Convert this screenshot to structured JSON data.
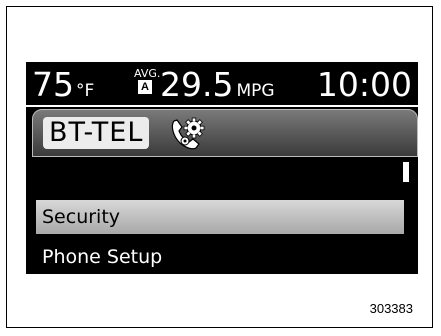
{
  "status": {
    "temperature": "75",
    "temperature_unit": "°F",
    "avg_label": "AVG.",
    "avg_badge": "A",
    "mpg_value": "29.5",
    "mpg_unit": "MPG",
    "time": "10:00"
  },
  "header": {
    "title": "BT-TEL",
    "icon": "phone-gear-icon"
  },
  "menu": {
    "items": [
      {
        "label": "Security",
        "selected": true
      },
      {
        "label": "Phone Setup",
        "selected": false
      }
    ]
  },
  "figure_id": "303383",
  "colors": {
    "screen_bg": "#000000",
    "selected_row": "#c8c8c8",
    "header_gradient_top": "#7a7a7a",
    "header_gradient_bottom": "#3a3a3a"
  }
}
